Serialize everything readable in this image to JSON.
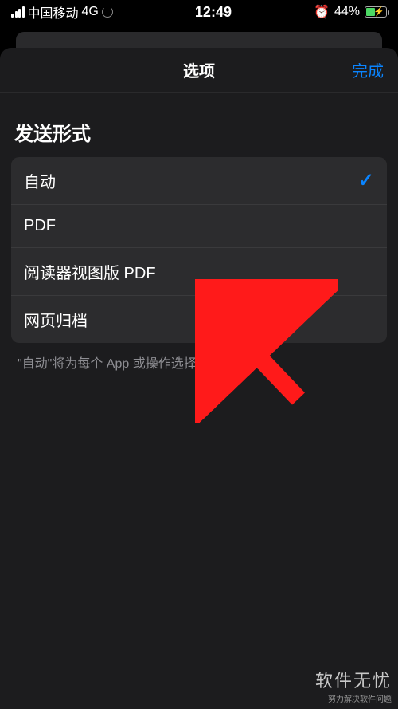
{
  "status": {
    "carrier": "中国移动",
    "network": "4G",
    "time": "12:49",
    "battery_pct": "44%"
  },
  "modal": {
    "title": "选项",
    "done": "完成"
  },
  "section": {
    "label": "发送形式",
    "options": [
      {
        "label": "自动",
        "selected": true
      },
      {
        "label": "PDF",
        "selected": false
      },
      {
        "label": "阅读器视图版 PDF",
        "selected": false
      },
      {
        "label": "网页归档",
        "selected": false
      }
    ],
    "footer": "\"自动\"将为每个 App 或操作选择最适合的格式。"
  },
  "watermark": {
    "title": "软件无忧",
    "subtitle": "努力解决软件问题"
  }
}
